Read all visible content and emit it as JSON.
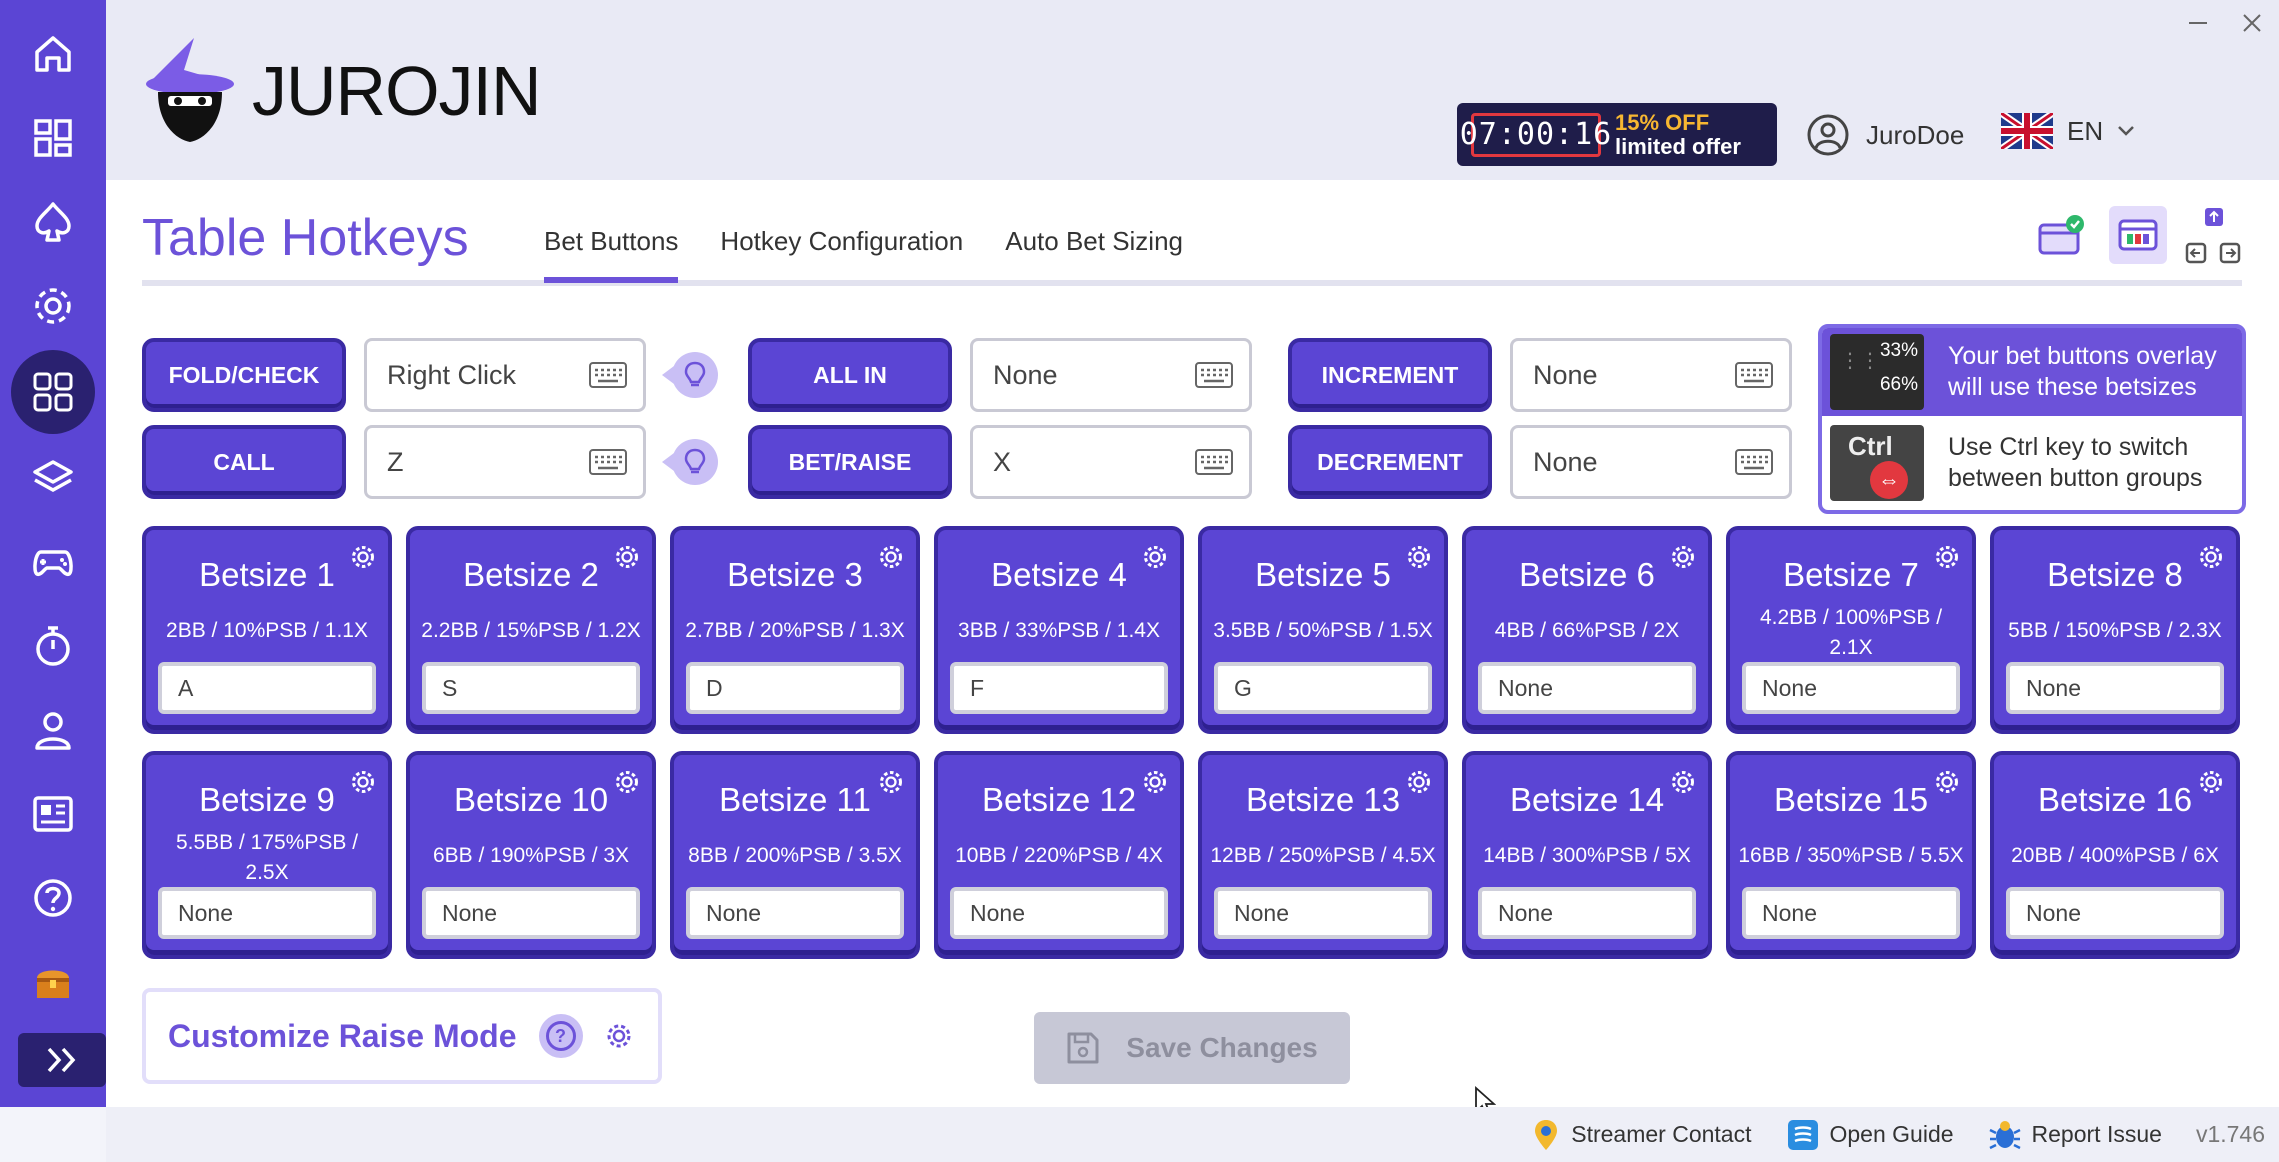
{
  "app": {
    "logo_text": "JUROJIN",
    "version": "v1.746"
  },
  "promo": {
    "timer": "07:00:16",
    "discount": "15% OFF",
    "subtitle": "limited offer"
  },
  "user": {
    "name": "JuroDoe"
  },
  "language": {
    "code": "EN"
  },
  "page": {
    "title": "Table Hotkeys",
    "tabs": [
      {
        "label": "Bet Buttons",
        "active": true
      },
      {
        "label": "Hotkey Configuration",
        "active": false
      },
      {
        "label": "Auto Bet Sizing",
        "active": false
      }
    ]
  },
  "actions": [
    {
      "label": "FOLD/CHECK",
      "key": "Right Click"
    },
    {
      "label": "CALL",
      "key": "Z"
    },
    {
      "label": "ALL IN",
      "key": "None"
    },
    {
      "label": "BET/RAISE",
      "key": "X"
    },
    {
      "label": "INCREMENT",
      "key": "None"
    },
    {
      "label": "DECREMENT",
      "key": "None"
    }
  ],
  "info": {
    "thumb_top_1": "33%",
    "thumb_top_2": "66%",
    "overlay_text": "Your bet buttons overlay will use these betsizes",
    "thumb_bottom": "Ctrl",
    "ctrl_text": "Use Ctrl key to switch between button groups"
  },
  "bets": [
    {
      "title": "Betsize 1",
      "desc": "2BB / 10%PSB / 1.1X",
      "key": "A"
    },
    {
      "title": "Betsize 2",
      "desc": "2.2BB / 15%PSB / 1.2X",
      "key": "S"
    },
    {
      "title": "Betsize 3",
      "desc": "2.7BB / 20%PSB / 1.3X",
      "key": "D"
    },
    {
      "title": "Betsize 4",
      "desc": "3BB / 33%PSB / 1.4X",
      "key": "F"
    },
    {
      "title": "Betsize 5",
      "desc": "3.5BB / 50%PSB / 1.5X",
      "key": "G"
    },
    {
      "title": "Betsize 6",
      "desc": "4BB / 66%PSB / 2X",
      "key": "None"
    },
    {
      "title": "Betsize 7",
      "desc": "4.2BB / 100%PSB / 2.1X",
      "key": "None"
    },
    {
      "title": "Betsize 8",
      "desc": "5BB / 150%PSB / 2.3X",
      "key": "None"
    },
    {
      "title": "Betsize 9",
      "desc": "5.5BB / 175%PSB / 2.5X",
      "key": "None"
    },
    {
      "title": "Betsize 10",
      "desc": "6BB / 190%PSB / 3X",
      "key": "None"
    },
    {
      "title": "Betsize 11",
      "desc": "8BB / 200%PSB / 3.5X",
      "key": "None"
    },
    {
      "title": "Betsize 12",
      "desc": "10BB / 220%PSB / 4X",
      "key": "None"
    },
    {
      "title": "Betsize 13",
      "desc": "12BB / 250%PSB / 4.5X",
      "key": "None"
    },
    {
      "title": "Betsize 14",
      "desc": "14BB / 300%PSB / 5X",
      "key": "None"
    },
    {
      "title": "Betsize 15",
      "desc": "16BB / 350%PSB / 5.5X",
      "key": "None"
    },
    {
      "title": "Betsize 16",
      "desc": "20BB / 400%PSB / 6X",
      "key": "None"
    }
  ],
  "raise_mode": {
    "title": "Customize Raise Mode",
    "help": "?"
  },
  "save": {
    "label": "Save Changes"
  },
  "footer": {
    "streamer": "Streamer Contact",
    "guide": "Open Guide",
    "report": "Report Issue"
  },
  "colors": {
    "primary": "#5b45d4",
    "primary_dark": "#3a2aa3",
    "accent": "#6c52d9"
  }
}
